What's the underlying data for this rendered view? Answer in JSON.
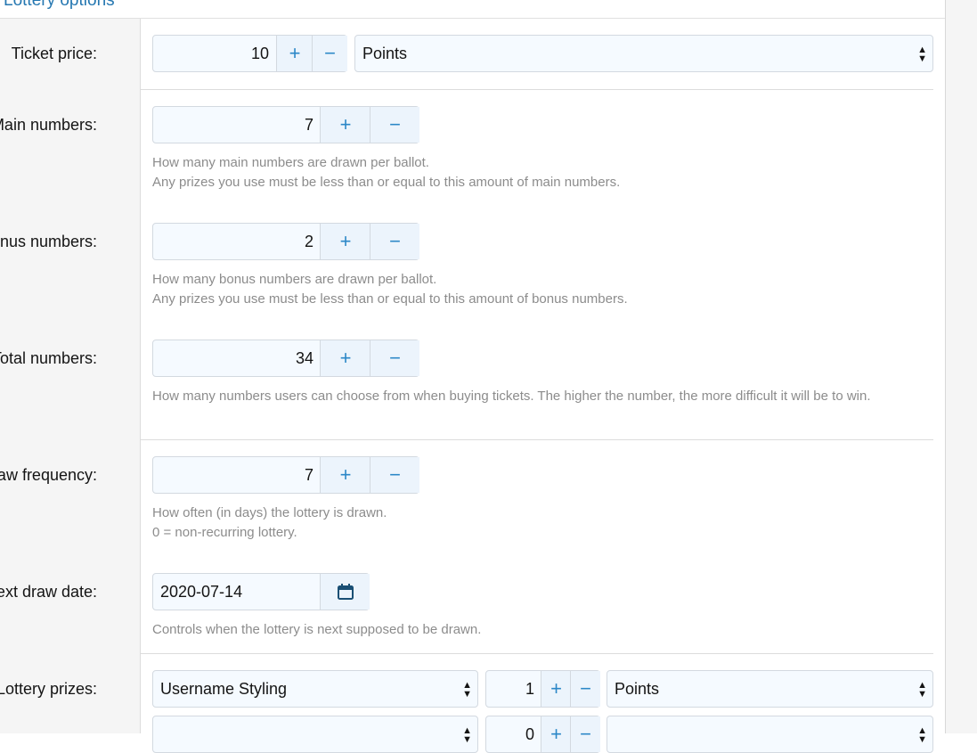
{
  "section": {
    "title": "Lottery options",
    "toggle_icon": "chevron-up-icon"
  },
  "ticket_price": {
    "label": "Ticket price:",
    "value": "10",
    "plus": "+",
    "minus": "−",
    "currency": "Points"
  },
  "main_numbers": {
    "label": "Main numbers:",
    "value": "7",
    "plus": "+",
    "minus": "−",
    "hint1": "How many main numbers are drawn per ballot.",
    "hint2": "Any prizes you use must be less than or equal to this amount of main numbers."
  },
  "bonus_numbers": {
    "label": "Bonus numbers:",
    "value": "2",
    "plus": "+",
    "minus": "−",
    "hint1": "How many bonus numbers are drawn per ballot.",
    "hint2": "Any prizes you use must be less than or equal to this amount of bonus numbers."
  },
  "total_numbers": {
    "label": "Total numbers:",
    "value": "34",
    "plus": "+",
    "minus": "−",
    "hint": "How many numbers users can choose from when buying tickets. The higher the number, the more difficult it will be to win."
  },
  "draw_frequency": {
    "label": "Draw frequency:",
    "value": "7",
    "plus": "+",
    "minus": "−",
    "hint1": "How often (in days) the lottery is drawn.",
    "hint2": "0 = non-recurring lottery."
  },
  "next_draw_date": {
    "label": "Next draw date:",
    "value": "2020-07-14",
    "icon": "calendar-icon",
    "hint": "Controls when the lottery is next supposed to be drawn."
  },
  "lottery_prizes": {
    "label": "Lottery prizes:",
    "rows": [
      {
        "type": "Username Styling",
        "value": "1",
        "plus": "+",
        "minus": "−",
        "currency": "Points"
      },
      {
        "type": "",
        "value": "0",
        "plus": "+",
        "minus": "−",
        "currency": ""
      }
    ]
  }
}
